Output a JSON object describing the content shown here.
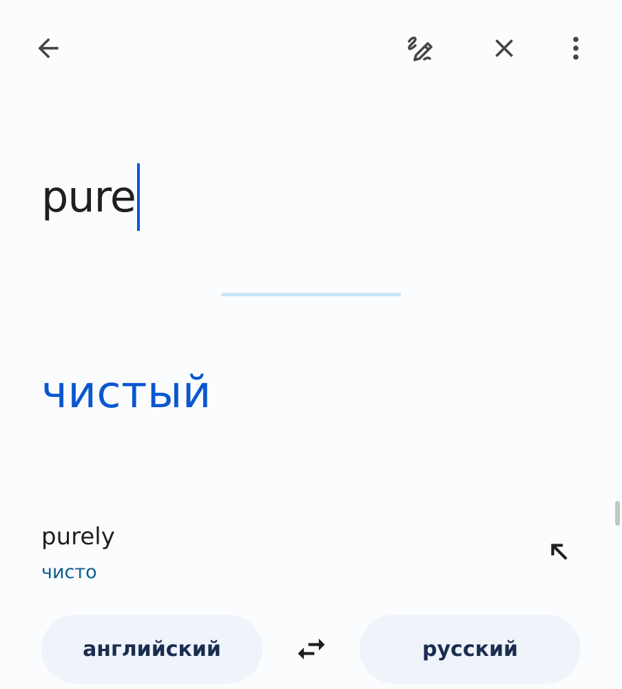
{
  "toolbar": {
    "back_icon": "arrow-back-icon",
    "handwrite_icon": "handwriting-icon",
    "clear_icon": "close-icon",
    "more_icon": "more-vert-icon"
  },
  "source": {
    "text": "pure"
  },
  "translation": {
    "text": "чистый"
  },
  "suggestion": {
    "term": "purely",
    "translation": "чисто",
    "icon": "arrow-up-left-icon"
  },
  "languages": {
    "source": "английский",
    "target": "русский",
    "swap_icon": "swap-icon"
  },
  "colors": {
    "accent": "#0b57d0",
    "suggestion_translation": "#0b5f8e",
    "pill_bg": "#eff3fa",
    "divider": "#c9e7f8"
  }
}
